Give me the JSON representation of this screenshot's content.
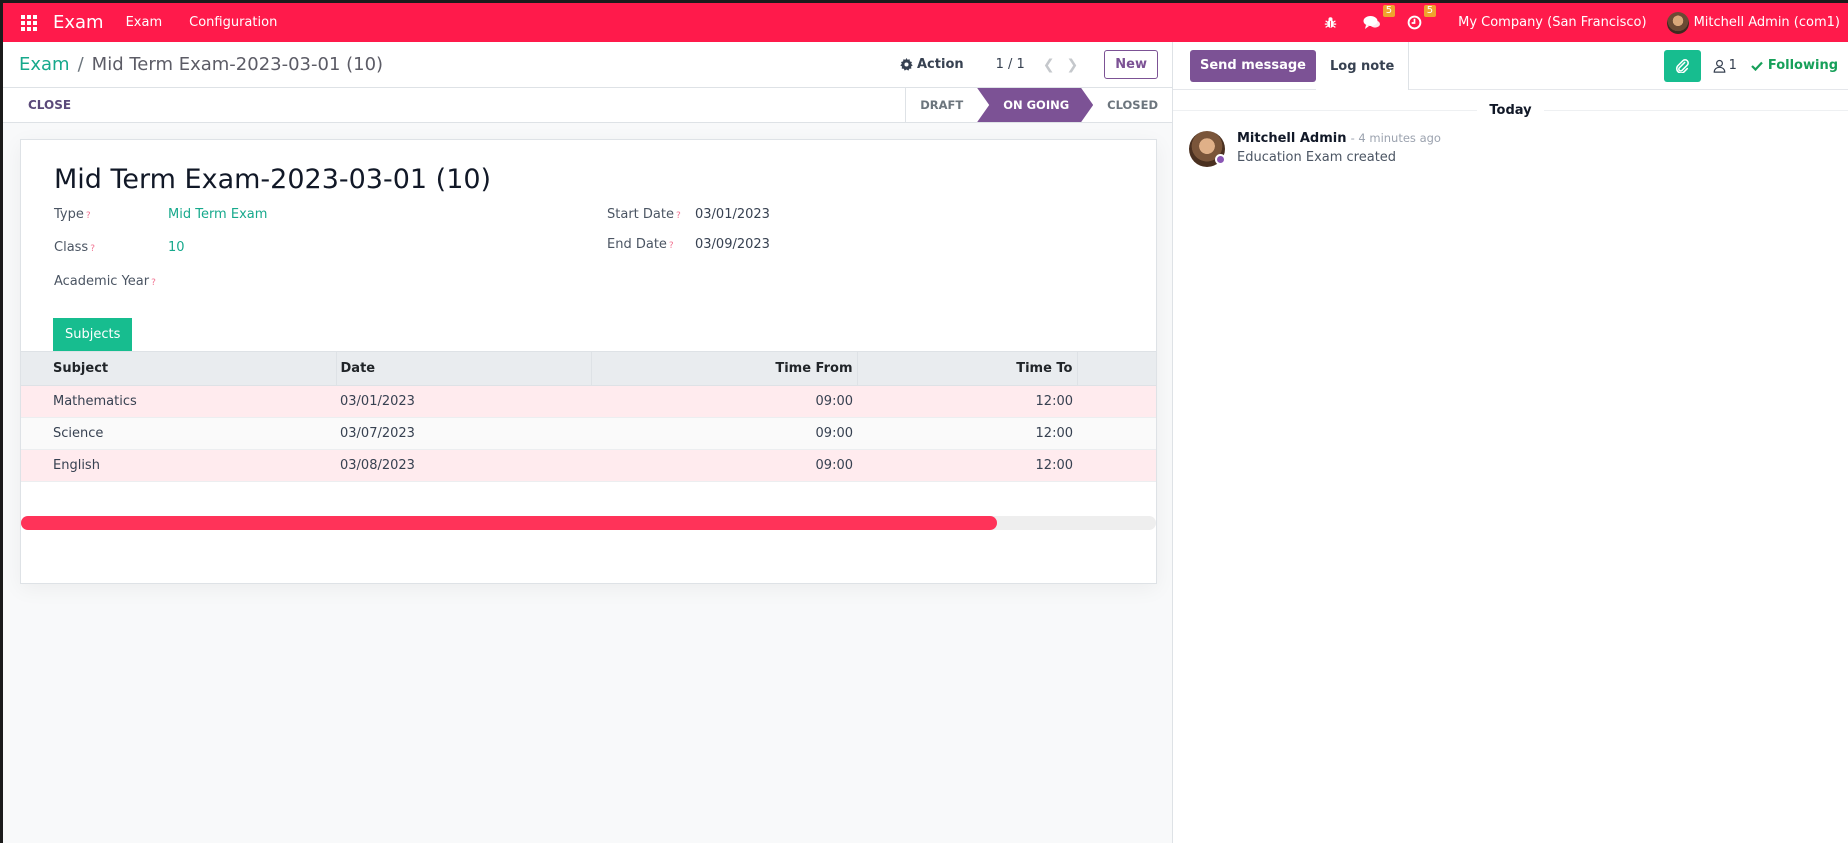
{
  "navbar": {
    "app_name": "Exam",
    "menus": [
      "Exam",
      "Configuration"
    ],
    "messages_count": "5",
    "activities_count": "5",
    "company": "My Company (San Francisco)",
    "user": "Mitchell Admin (com1)",
    "color": "#ff1a4b"
  },
  "control_panel": {
    "breadcrumb_parent": "Exam",
    "breadcrumb_separator": "/",
    "breadcrumb_current": "Mid Term Exam-2023-03-01 (10)",
    "action_label": "Action",
    "pager": "1 / 1",
    "new_label": "New"
  },
  "statusbar": {
    "close_label": "CLOSE",
    "steps": [
      "DRAFT",
      "ON GOING",
      "CLOSED"
    ],
    "active_step": "ON GOING"
  },
  "form": {
    "title": "Mid Term Exam-2023-03-01 (10)",
    "fields": {
      "type_label": "Type",
      "type_value": "Mid Term Exam",
      "class_label": "Class",
      "class_value": "10",
      "academic_year_label": "Academic Year",
      "academic_year_value": "",
      "start_date_label": "Start Date",
      "start_date_value": "03/01/2023",
      "end_date_label": "End Date",
      "end_date_value": "03/09/2023"
    },
    "help_marker": "?",
    "tab_label": "Subjects",
    "table": {
      "columns": [
        "Subject",
        "Date",
        "Time From",
        "Time To"
      ],
      "rows": [
        {
          "subject": "Mathematics",
          "date": "03/01/2023",
          "time_from": "09:00",
          "time_to": "12:00"
        },
        {
          "subject": "Science",
          "date": "03/07/2023",
          "time_from": "09:00",
          "time_to": "12:00"
        },
        {
          "subject": "English",
          "date": "03/08/2023",
          "time_from": "09:00",
          "time_to": "12:00"
        }
      ]
    },
    "horizontal_scroll_visible_fraction": 0.86
  },
  "chatter": {
    "send_message_label": "Send message",
    "log_note_label": "Log note",
    "followers_count": "1",
    "following_label": "Following",
    "day_separator": "Today",
    "messages": [
      {
        "author": "Mitchell Admin",
        "date": "- 4 minutes ago",
        "body": "Education Exam created"
      }
    ]
  },
  "colors": {
    "primary": "#7c5295",
    "accent_green": "#17bd8f",
    "link": "#17a98c",
    "row_highlight": "#ffebee",
    "scroll_thumb": "#ff3359"
  }
}
